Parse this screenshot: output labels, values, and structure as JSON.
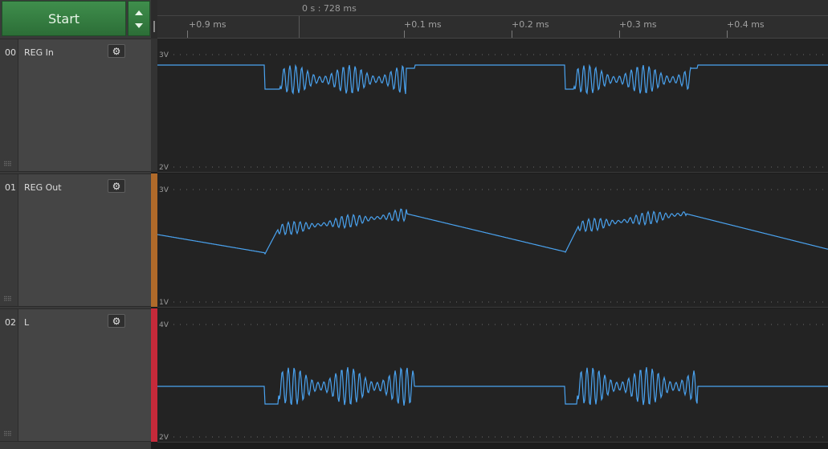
{
  "toolbar": {
    "start_label": "Start"
  },
  "ruler": {
    "cursor_time": "0 s : 728 ms",
    "ticks": [
      "+0.9 ms",
      "+0.1 ms",
      "+0.2 ms",
      "+0.3 ms",
      "+0.4 ms"
    ]
  },
  "channels": [
    {
      "num": "00",
      "name": "REG In",
      "top_label": "3V",
      "bottom_label": "2V",
      "color": "#4aa3f0",
      "strip_color": "#333333"
    },
    {
      "num": "01",
      "name": "REG Out",
      "top_label": "3V",
      "bottom_label": "1V",
      "color": "#4aa3f0",
      "strip_color": "#b06a2a"
    },
    {
      "num": "02",
      "name": "L",
      "top_label": "4V",
      "bottom_label": "2V",
      "color": "#4aa3f0",
      "strip_color": "#c52a3a"
    }
  ],
  "icons": {
    "settings": "gear-icon",
    "start_menu": "up-down-arrows-icon",
    "drag": "grip-icon"
  }
}
